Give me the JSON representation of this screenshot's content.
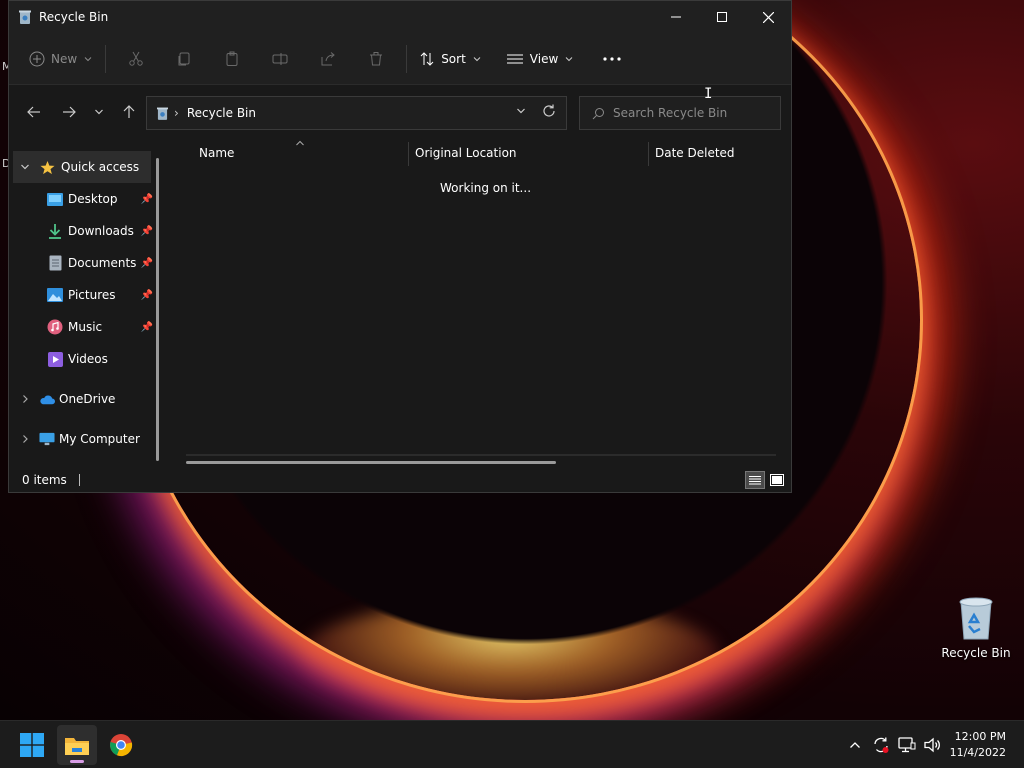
{
  "window": {
    "title": "Recycle Bin"
  },
  "toolbar": {
    "new_label": "New",
    "sort_label": "Sort",
    "view_label": "View"
  },
  "address": {
    "crumb": "Recycle Bin"
  },
  "search": {
    "placeholder": "Search Recycle Bin"
  },
  "sidebar": {
    "items": [
      {
        "label": "Quick access",
        "icon": "star-icon"
      },
      {
        "label": "Desktop",
        "icon": "desktop-icon"
      },
      {
        "label": "Downloads",
        "icon": "download-icon"
      },
      {
        "label": "Documents",
        "icon": "document-icon"
      },
      {
        "label": "Pictures",
        "icon": "pictures-icon"
      },
      {
        "label": "Music",
        "icon": "music-icon"
      },
      {
        "label": "Videos",
        "icon": "video-icon"
      },
      {
        "label": "OneDrive",
        "icon": "cloud-icon"
      },
      {
        "label": "My Computer",
        "icon": "computer-icon"
      }
    ]
  },
  "columns": {
    "name": "Name",
    "original_location": "Original Location",
    "date_deleted": "Date Deleted"
  },
  "content": {
    "status_message": "Working on it..."
  },
  "status": {
    "items_count": "0 items"
  },
  "desktop": {
    "recycle_bin_label": "Recycle Bin",
    "edge_label_1": "M",
    "edge_label_2": "D"
  },
  "taskbar": {
    "time": "12:00 PM",
    "date": "11/4/2022"
  },
  "colors": {
    "accent": "#0078d4",
    "window_bg": "#191919",
    "titlebar_bg": "#202020",
    "taskbar_bg": "#1c1c1c"
  }
}
